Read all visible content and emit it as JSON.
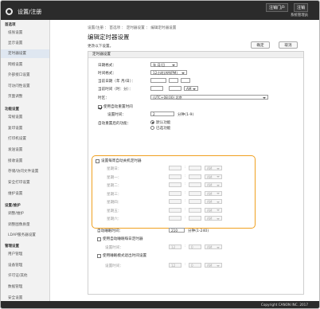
{
  "header": {
    "title": "设置/注册",
    "links": [
      "注销门户",
      "注销"
    ],
    "user": "系统管理员"
  },
  "sidebar": {
    "sections": [
      "首选项",
      "功能设置",
      "设置/维护",
      "管理设置"
    ],
    "items": [
      "纸张设置",
      "显示设置",
      "定时器设置",
      "网络设置",
      "外部接口设置",
      "可访问性设置",
      "页面调整",
      "常规设置",
      "复印设置",
      "打印机设置",
      "发送设置",
      "接收设置",
      "存储/访问文件设置",
      "安全打印设置",
      "维护设置",
      "调整/维护",
      "调整图像质量",
      "LDAP服务器设置",
      "用户管理",
      "设备管理",
      "许可证/其他",
      "数据管理",
      "安全设置"
    ]
  },
  "breadcrumb": "设置/注册 ： 首选项 ： 定时器设置 ： 编辑定时器设置",
  "page_title": "编辑定时器设置",
  "instruction": "更改以下设置。",
  "buttons": {
    "ok": "确定",
    "cancel": "取消"
  },
  "panel_title": "定时器设置",
  "date_time": {
    "date_format_label": "日期格式：",
    "date_format_value": "年 月/日",
    "time_format_label": "时间格式：",
    "time_format_value": "12小时(AM/PM)",
    "current_date_label": "当前日期（年 月/日）：",
    "current_time_label": "当前时间（时：分）：",
    "ampm_value": "AM",
    "timezone_label": "时区：",
    "timezone_value": "(UTC+08:00) 北京"
  },
  "auto_reset": {
    "checkbox_label": "使用自动重置时间",
    "time_label": "设置时间：",
    "time_value": "2",
    "unit": "分钟(1-9)"
  },
  "auto_reset_function": {
    "label": "自动重置后的功能：",
    "options": [
      "默认功能",
      "已选功能"
    ]
  },
  "weekly": {
    "checkbox_label": "设置每周自动关机定时器",
    "days": [
      "星期日：",
      "星期一：",
      "星期二：",
      "星期三：",
      "星期四：",
      "星期五：",
      "星期六："
    ],
    "ampm": "AM"
  },
  "auto_sleep": {
    "label": "自动睡眠时间：",
    "value": "210",
    "unit": "分钟(1-240)"
  },
  "daily_sleep": {
    "checkbox_label": "使用自动睡眠每日定时器",
    "time_label": "设置时间：",
    "hour": "12",
    "minute": "0",
    "ampm": "AM"
  },
  "exit_sleep": {
    "checkbox_label": "使用睡眠模式退出时间设置",
    "time_label": "设置时间：",
    "hour": "12",
    "minute": "0",
    "ampm": "AM"
  },
  "footer": "Copyright CANON INC. 2017"
}
